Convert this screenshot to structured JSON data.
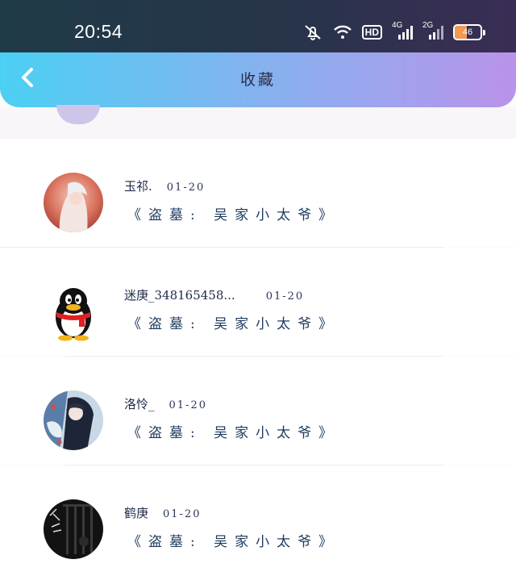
{
  "status_bar": {
    "time": "20:54",
    "hd_label": "HD",
    "net_label_1": "4G",
    "net_label_2": "2G",
    "battery_percent": 46
  },
  "header": {
    "title": "收藏"
  },
  "favorites": [
    {
      "name": "玉祁.",
      "date": "01-20",
      "book": "《盗墓: 吴家小太爷》"
    },
    {
      "name": "迷庚_348165458...",
      "date": "01-20",
      "book": "《盗墓: 吴家小太爷》"
    },
    {
      "name": "洛怜_",
      "date": "01-20",
      "book": "《盗墓: 吴家小太爷》"
    },
    {
      "name": "鹤庚",
      "date": "01-20",
      "book": "《盗墓: 吴家小太爷》"
    }
  ],
  "colors": {
    "nav_gradient_start": "#4bd0f3",
    "nav_gradient_end": "#b993ea",
    "text_dark": "#1d3a5e"
  }
}
